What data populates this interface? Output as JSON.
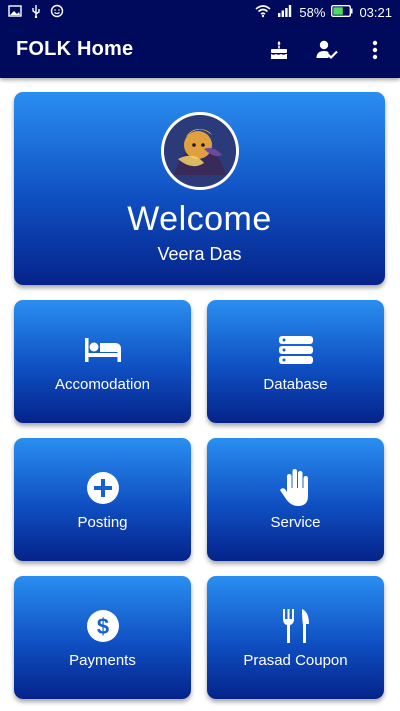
{
  "status_bar": {
    "battery_percent": "58%",
    "time": "03:21"
  },
  "app_bar": {
    "title": "FOLK Home",
    "actions": [
      "cake-icon",
      "person-check-icon",
      "more-vert-icon"
    ]
  },
  "welcome": {
    "title": "Welcome",
    "name": "Veera Das"
  },
  "tiles": [
    {
      "label": "Accomodation",
      "icon": "bed-icon"
    },
    {
      "label": "Database",
      "icon": "database-icon"
    },
    {
      "label": "Posting",
      "icon": "add-circle-icon"
    },
    {
      "label": "Service",
      "icon": "hand-icon"
    },
    {
      "label": "Payments",
      "icon": "dollar-icon"
    },
    {
      "label": "Prasad Coupon",
      "icon": "restaurant-icon"
    }
  ],
  "colors": {
    "app_bar": "#000a5c",
    "card_top": "#2a8ef0",
    "card_bottom": "#05238a",
    "battery_fill": "#4cd964"
  }
}
